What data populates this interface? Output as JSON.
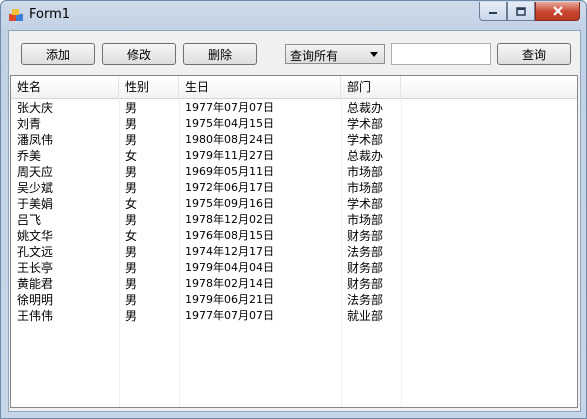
{
  "window": {
    "title": "Form1"
  },
  "toolbar": {
    "add_label": "添加",
    "edit_label": "修改",
    "delete_label": "删除",
    "query_select": "查询所有",
    "search_value": "",
    "query_label": "查询"
  },
  "table": {
    "columns": [
      "姓名",
      "性别",
      "生日",
      "部门"
    ],
    "rows": [
      [
        "张大庆",
        "男",
        "1977年07月07日",
        "总裁办"
      ],
      [
        "刘青",
        "男",
        "1975年04月15日",
        "学术部"
      ],
      [
        "潘凤伟",
        "男",
        "1980年08月24日",
        "学术部"
      ],
      [
        "乔美",
        "女",
        "1979年11月27日",
        "总裁办"
      ],
      [
        "周天应",
        "男",
        "1969年05月11日",
        "市场部"
      ],
      [
        "吴少斌",
        "男",
        "1972年06月17日",
        "市场部"
      ],
      [
        "于美娟",
        "女",
        "1975年09月16日",
        "学术部"
      ],
      [
        "吕飞",
        "男",
        "1978年12月02日",
        "市场部"
      ],
      [
        "姚文华",
        "女",
        "1976年08月15日",
        "财务部"
      ],
      [
        "孔文远",
        "男",
        "1974年12月17日",
        "法务部"
      ],
      [
        "王长亭",
        "男",
        "1979年04月04日",
        "财务部"
      ],
      [
        "黄能君",
        "男",
        "1978年02月14日",
        "财务部"
      ],
      [
        "徐明明",
        "男",
        "1979年06月21日",
        "法务部"
      ],
      [
        "王伟伟",
        "男",
        "1977年07月07日",
        "就业部"
      ]
    ]
  }
}
